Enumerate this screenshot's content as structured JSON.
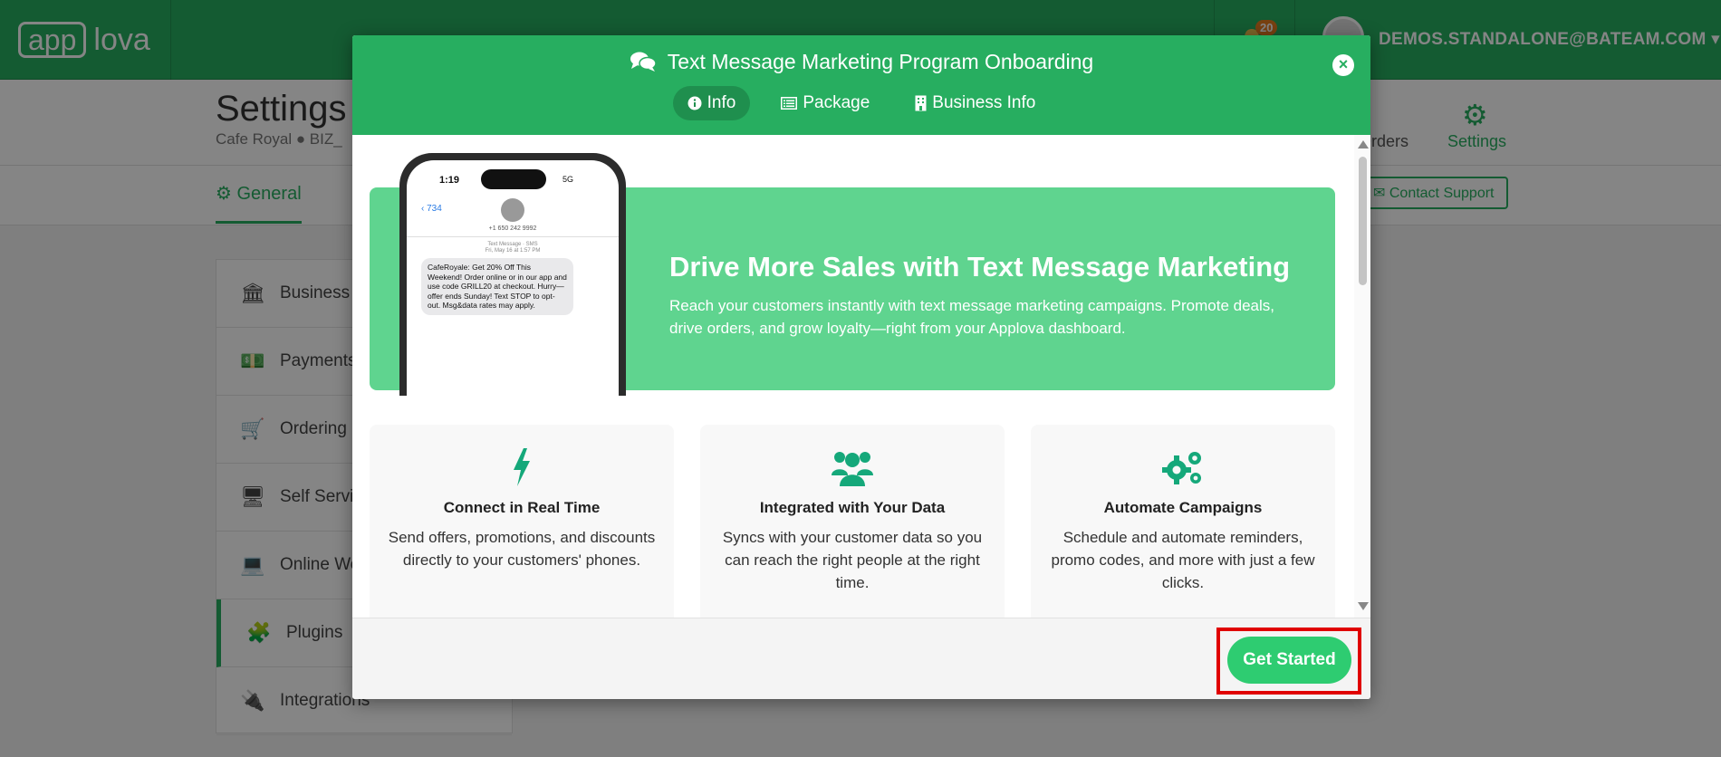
{
  "app": {
    "logo_part1": "app",
    "logo_part2": "lova",
    "notification_count": "20",
    "user_email": "DEMOS.STANDALONE@BATEAM.COM",
    "user_caret": "▾"
  },
  "page": {
    "title": "Settings",
    "breadcrumb": "Cafe Royal  ●  BIZ_",
    "nav_orders": "Orders",
    "nav_settings": "Settings",
    "tab_general": "General",
    "contact_support": "Contact Support"
  },
  "sidebar": {
    "items": [
      {
        "label": "Business D",
        "icon": "bank-icon"
      },
      {
        "label": "Payments",
        "icon": "money-icon"
      },
      {
        "label": "Ordering M",
        "icon": "cart-icon"
      },
      {
        "label": "Self Servic",
        "icon": "monitor-icon"
      },
      {
        "label": "Online We",
        "icon": "laptop-icon"
      },
      {
        "label": "Plugins",
        "icon": "puzzle-icon"
      },
      {
        "label": "Integrations",
        "icon": "plug-icon"
      }
    ]
  },
  "modal": {
    "title": "Text Message Marketing Program Onboarding",
    "close": "×",
    "tabs": [
      {
        "label": "Info",
        "icon": "info-icon"
      },
      {
        "label": "Package",
        "icon": "list-icon"
      },
      {
        "label": "Business Info",
        "icon": "building-icon"
      }
    ],
    "phone": {
      "time": "1:19",
      "status": "5G",
      "back_count": "734",
      "number": "+1 650 242 9992",
      "meta_line1": "Text Message · SMS",
      "meta_line2": "Fri, May 16 at 1:57 PM",
      "message": "CafeRoyale: Get 20% Off This Weekend! Order online or in our app and use code GRILL20 at checkout. Hurry—offer ends Sunday! Text STOP to opt-out. Msg&data rates may apply."
    },
    "hero": {
      "headline": "Drive More Sales with Text Message Marketing",
      "subtext": "Reach your customers instantly with text message marketing campaigns. Promote deals, drive orders, and grow loyalty—right from your Applova dashboard."
    },
    "features": [
      {
        "title": "Connect in Real Time",
        "description": "Send offers, promotions, and discounts directly to your customers' phones.",
        "icon": "bolt-icon"
      },
      {
        "title": "Integrated with Your Data",
        "description": "Syncs with your customer data so you can reach the right people at the right time.",
        "icon": "users-icon"
      },
      {
        "title": "Automate Campaigns",
        "description": "Schedule and automate reminders, promo codes, and more with just a few clicks.",
        "icon": "gears-icon"
      }
    ],
    "get_started": "Get Started"
  },
  "colors": {
    "brand_green": "#27ae60",
    "hero_green": "#5fd48f",
    "button_green": "#2ecc71",
    "highlight_red": "#e00000"
  }
}
